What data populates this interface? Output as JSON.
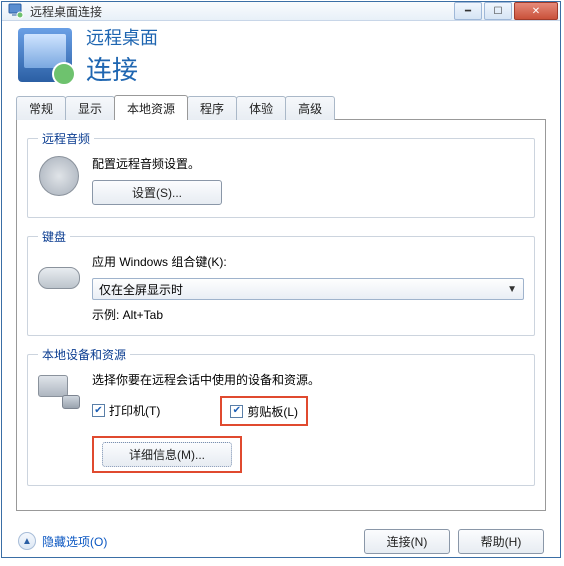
{
  "window": {
    "title": "远程桌面连接"
  },
  "header": {
    "line1": "远程桌面",
    "line2": "连接"
  },
  "tabs": [
    {
      "label": "常规"
    },
    {
      "label": "显示"
    },
    {
      "label": "本地资源"
    },
    {
      "label": "程序"
    },
    {
      "label": "体验"
    },
    {
      "label": "高级"
    }
  ],
  "active_tab_index": 2,
  "audio": {
    "legend": "远程音频",
    "desc": "配置远程音频设置。",
    "settings_btn": "设置(S)..."
  },
  "keyboard": {
    "legend": "键盘",
    "desc": "应用 Windows 组合键(K):",
    "select_value": "仅在全屏显示时",
    "example": "示例: Alt+Tab"
  },
  "devices": {
    "legend": "本地设备和资源",
    "desc": "选择你要在远程会话中使用的设备和资源。",
    "printer_label": "打印机(T)",
    "clipboard_label": "剪贴板(L)",
    "details_btn": "详细信息(M)..."
  },
  "footer": {
    "hide_options": "隐藏选项(O)",
    "connect": "连接(N)",
    "help": "帮助(H)"
  }
}
